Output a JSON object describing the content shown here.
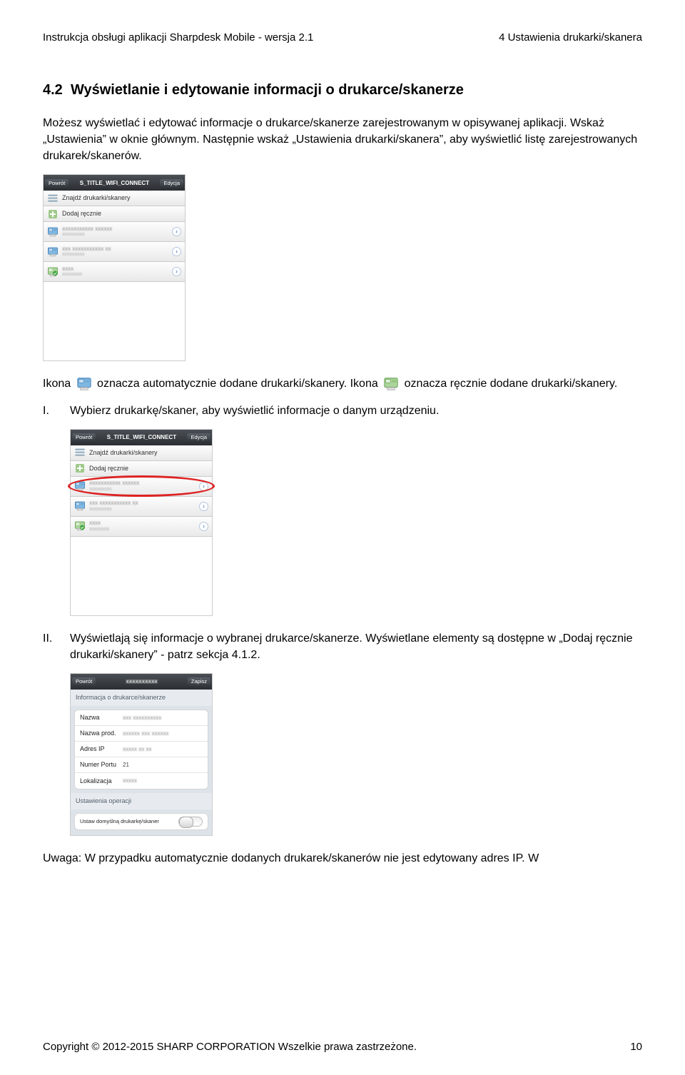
{
  "header": {
    "left": "Instrukcja obsługi aplikacji Sharpdesk Mobile - wersja 2.1",
    "right": "4 Ustawienia drukarki/skanera"
  },
  "section": {
    "number": "4.2",
    "title": "Wyświetlanie i edytowanie informacji o drukarce/skanerze"
  },
  "body": {
    "p1": "Możesz wyświetlać i edytować informacje o drukarce/skanerze zarejestrowanym w opisywanej aplikacji. Wskaż „Ustawienia” w oknie głównym. Następnie wskaż „Ustawienia drukarki/skanera”, aby wyświetlić listę zarejestrowanych drukarek/skanerów.",
    "icon_para_a": "Ikona",
    "icon_para_b": "oznacza automatycznie dodane drukarki/skanery. Ikona",
    "icon_para_c": "oznacza ręcznie dodane drukarki/skanery.",
    "step1_num": "I.",
    "step1_txt": "Wybierz drukarkę/skaner, aby wyświetlić informacje o danym urządzeniu.",
    "step2_num": "II.",
    "step2_txt": "Wyświetlają się informacje o wybranej drukarce/skanerze. Wyświetlane elementy są dostępne w „Dodaj ręcznie drukarki/skanery” - patrz sekcja 4.1.2.",
    "note": "Uwaga: W przypadku automatycznie dodanych drukarek/skanerów nie jest edytowany adres IP. W"
  },
  "phone_list": {
    "nav_back": "Powrót",
    "nav_title": "S_TITLE_WIFI_CONNECT",
    "nav_edit": "Edycja",
    "row_find": "Znajdź drukarki/skanery",
    "row_add": "Dodaj ręcznie"
  },
  "phone_detail": {
    "nav_back": "Powrót",
    "nav_save": "Zapisz",
    "section1": "Informacja o drukarce/skanerze",
    "k_name": "Nazwa",
    "k_prod": "Nazwa prod.",
    "k_ip": "Adres IP",
    "k_port": "Numer Portu",
    "v_port": "21",
    "k_loc": "Lokalizacja",
    "section2": "Ustawienia operacji",
    "k_default": "Ustaw domyślną drukarkę/skaner"
  },
  "footer": {
    "left": "Copyright © 2012-2015 SHARP CORPORATION Wszelkie prawa zastrzeżone.",
    "right": "10"
  }
}
